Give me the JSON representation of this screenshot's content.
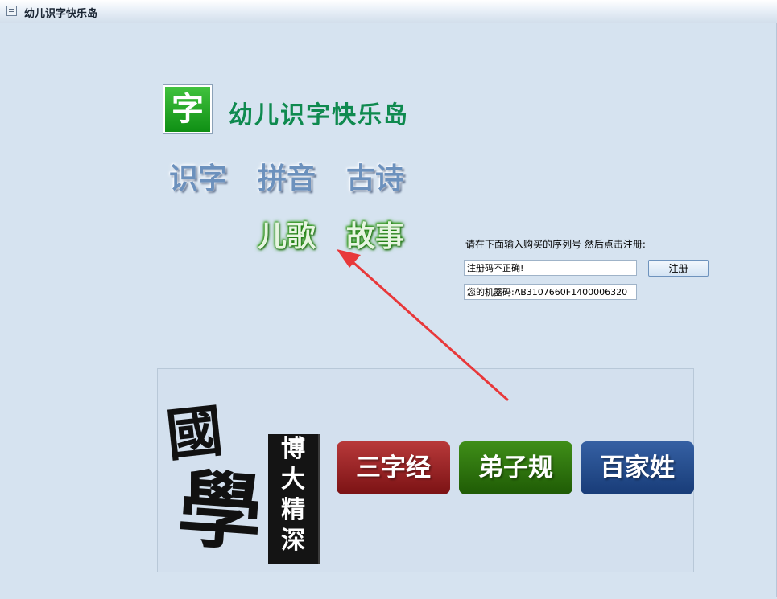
{
  "window": {
    "title": "幼儿识字快乐岛"
  },
  "app": {
    "logo_char": "字",
    "title": "幼儿识字快乐岛"
  },
  "menu": {
    "row1": [
      "识字",
      "拼音",
      "古诗"
    ],
    "row2": [
      "儿歌",
      "故事"
    ]
  },
  "registration": {
    "prompt": "请在下面输入购买的序列号 然后点击注册:",
    "serial_value": "注册码不正确!",
    "register_label": "注册",
    "machine_code_value": "您的机器码:AB3107660F1400006320"
  },
  "guoxue": {
    "logo_chars": [
      "國",
      "學"
    ],
    "banner": [
      "博",
      "大",
      "精",
      "深"
    ],
    "buttons": [
      "三字经",
      "弟子规",
      "百家姓"
    ]
  },
  "colors": {
    "annotation_arrow": "#e8383a",
    "title_green": "#0f8a4f"
  }
}
